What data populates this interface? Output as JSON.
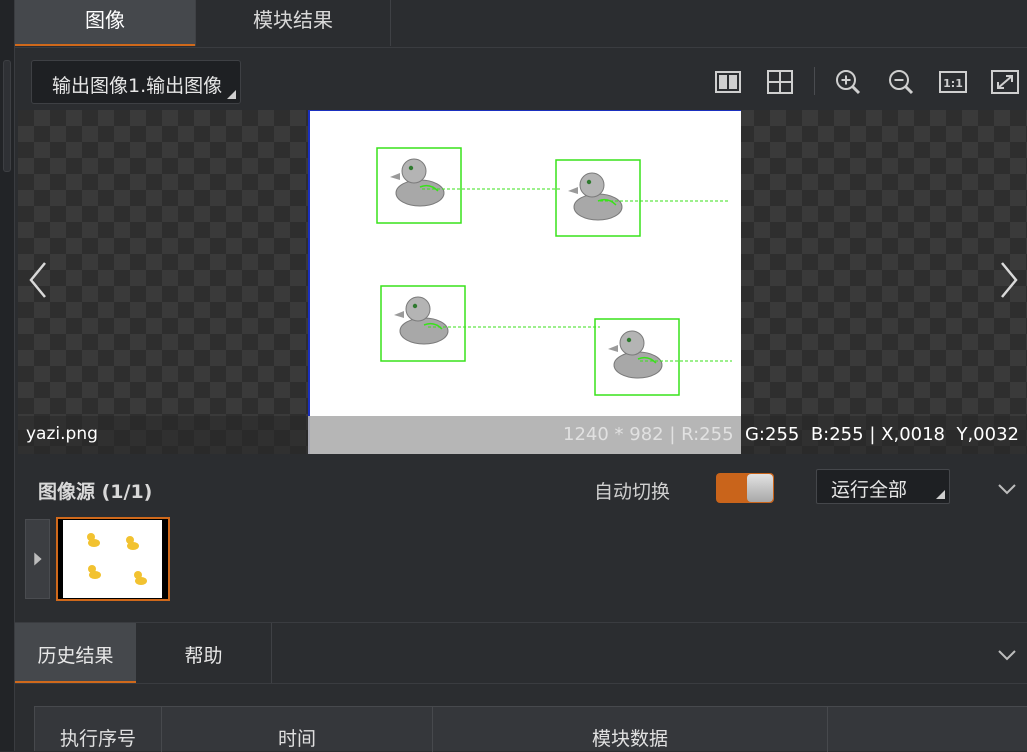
{
  "tabs": {
    "image": "图像",
    "module_result": "模块结果"
  },
  "toolbar": {
    "output_select": "输出图像1.输出图像",
    "tools": [
      "split-view-icon",
      "grid-view-icon",
      "zoom-in-icon",
      "zoom-out-icon",
      "actual-size-icon",
      "fit-screen-icon"
    ]
  },
  "viewer": {
    "filename": "yazi.png",
    "size": "1240 * 982",
    "sep": "|",
    "r": "R:255",
    "g": "G:255",
    "b": "B:255",
    "x": "X,0018",
    "y": "Y,0032"
  },
  "source": {
    "title": "图像源 (1/1)",
    "auto_switch": "自动切换",
    "auto_switch_on": true,
    "run_all": "运行全部"
  },
  "bottom_tabs": {
    "history": "历史结果",
    "help": "帮助"
  },
  "table": {
    "columns": [
      "执行序号",
      "时间",
      "模块数据",
      ""
    ]
  },
  "colors": {
    "accent": "#d0691b",
    "match_box": "#39e21a",
    "canvas_border": "#1a2fbf"
  }
}
